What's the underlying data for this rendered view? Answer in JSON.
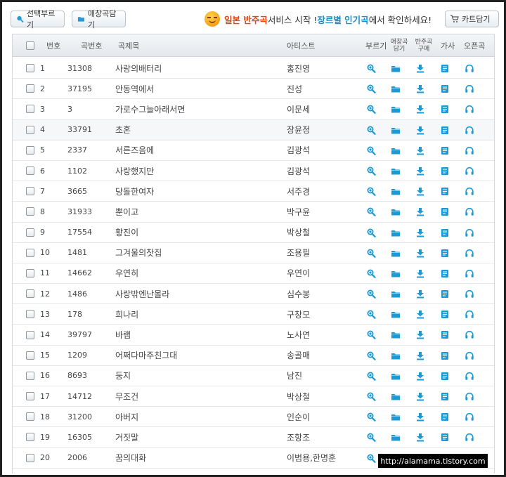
{
  "toolbar": {
    "select_label": "선택부르기",
    "fav_label": "애창곡담기",
    "cart_label": "카트담기",
    "promo_part1": "일본 반주곡",
    "promo_part2": " 서비스 시작 ! ",
    "promo_part3": "장르별 인기곡",
    "promo_part4": "에서 확인하세요!"
  },
  "columns": {
    "no": "번호",
    "code": "곡번호",
    "title": "곡제목",
    "artist": "아티스트",
    "sing": "부르기",
    "fav_1": "애창곡",
    "fav_2": "담기",
    "buy_1": "반주곡",
    "buy_2": "구매",
    "lyrics": "가사",
    "original": "오픈곡"
  },
  "rows": [
    {
      "no": "1",
      "code": "31308",
      "title": "사랑의배터리",
      "artist": "홍진영"
    },
    {
      "no": "2",
      "code": "37195",
      "title": "안동역에서",
      "artist": "진성"
    },
    {
      "no": "3",
      "code": "3",
      "title": "가로수그늘아래서면",
      "artist": "이문세"
    },
    {
      "no": "4",
      "code": "33791",
      "title": "초혼",
      "artist": "장윤정"
    },
    {
      "no": "5",
      "code": "2337",
      "title": "서른즈음에",
      "artist": "김광석"
    },
    {
      "no": "6",
      "code": "1102",
      "title": "사랑했지만",
      "artist": "김광석"
    },
    {
      "no": "7",
      "code": "3665",
      "title": "당돌한여자",
      "artist": "서주경"
    },
    {
      "no": "8",
      "code": "31933",
      "title": "뿐이고",
      "artist": "박구윤"
    },
    {
      "no": "9",
      "code": "17554",
      "title": "황진이",
      "artist": "박상철"
    },
    {
      "no": "10",
      "code": "1481",
      "title": "그겨울의찻집",
      "artist": "조용필"
    },
    {
      "no": "11",
      "code": "14662",
      "title": "우연히",
      "artist": "우연이"
    },
    {
      "no": "12",
      "code": "1486",
      "title": "사랑밖엔난몰라",
      "artist": "심수봉"
    },
    {
      "no": "13",
      "code": "178",
      "title": "희나리",
      "artist": "구창모"
    },
    {
      "no": "14",
      "code": "39797",
      "title": "바램",
      "artist": "노사연"
    },
    {
      "no": "15",
      "code": "1209",
      "title": "어쩌다마주친그대",
      "artist": "송골매"
    },
    {
      "no": "16",
      "code": "8693",
      "title": "둥지",
      "artist": "남진"
    },
    {
      "no": "17",
      "code": "14712",
      "title": "무조건",
      "artist": "박상철"
    },
    {
      "no": "18",
      "code": "31200",
      "title": "아버지",
      "artist": "인순이"
    },
    {
      "no": "19",
      "code": "16305",
      "title": "거짓말",
      "artist": "조항조"
    },
    {
      "no": "20",
      "code": "2006",
      "title": "꿈의대화",
      "artist": "이범용,한명훈"
    }
  ],
  "highlighted_row": "4",
  "icons": {
    "sing": "microphone-icon",
    "fav": "folder-icon",
    "buy": "download-icon",
    "lyrics": "lyrics-document-icon",
    "original": "headphones-icon"
  },
  "colors": {
    "icon_blue": "#1c9ad6",
    "promo_red": "#e8450c",
    "promo_blue": "#1a8fc6"
  },
  "watermark": "http://alamama.tistory.com"
}
